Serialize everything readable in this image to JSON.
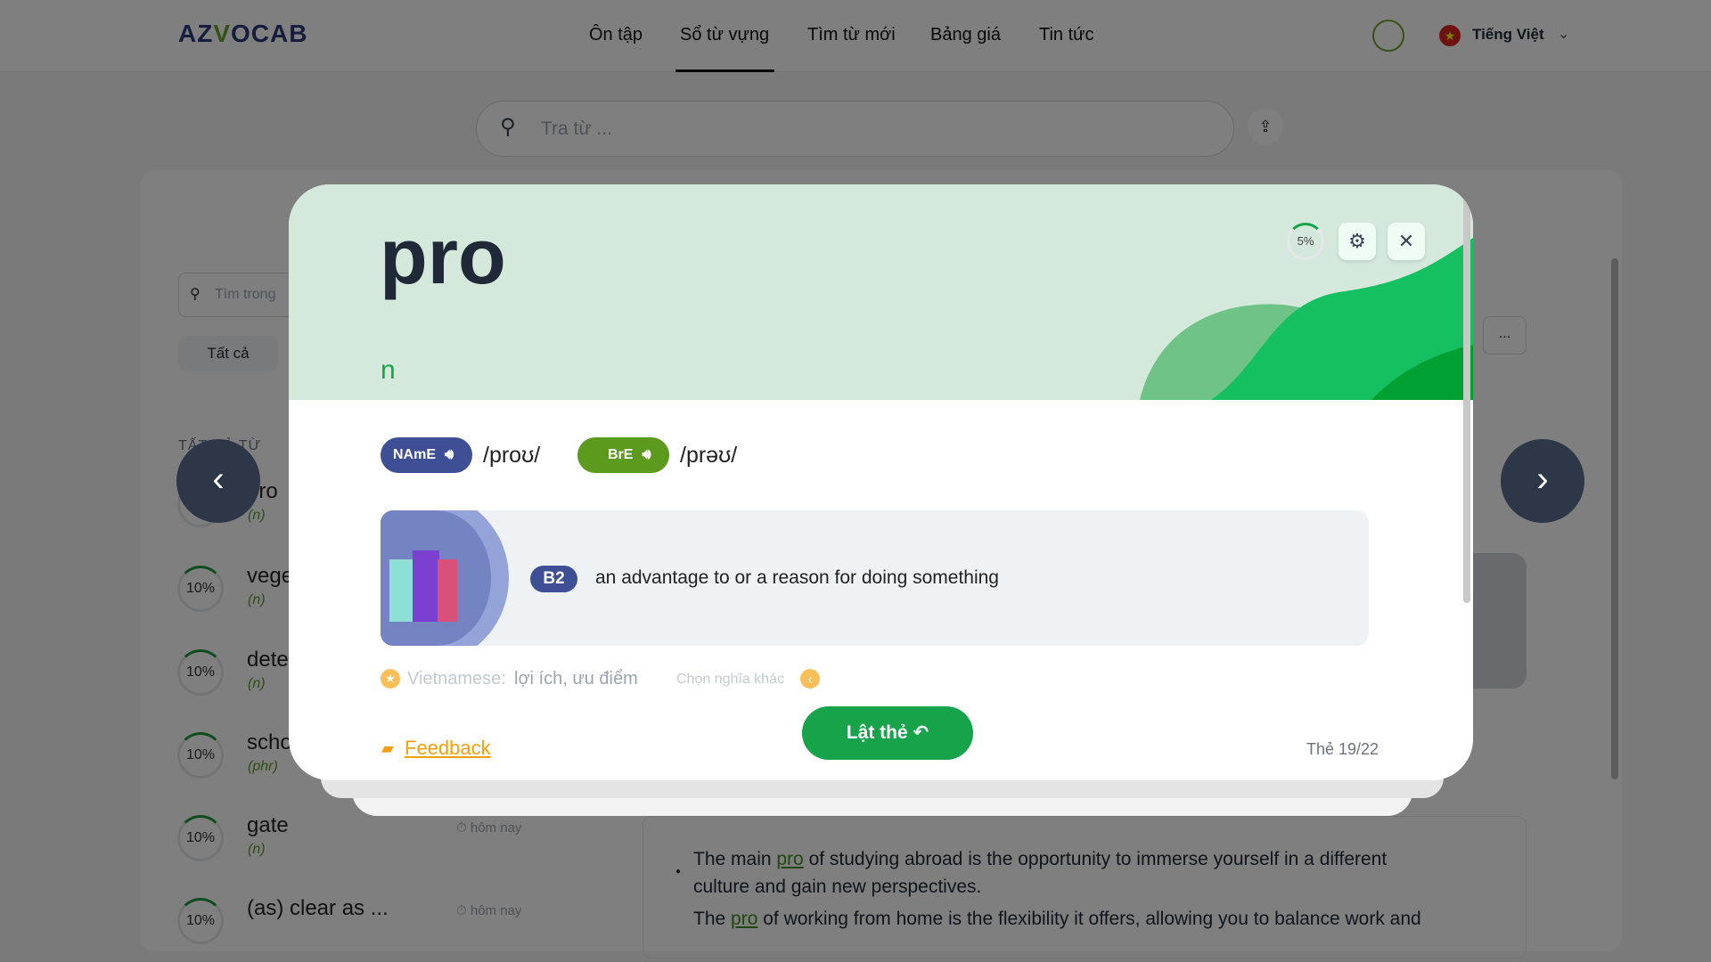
{
  "header": {
    "logo": "AZVOCAB",
    "nav": [
      "Ôn tập",
      "Sổ từ vựng",
      "Tìm từ mới",
      "Bảng giá",
      "Tin tức"
    ],
    "active_nav": "Sổ từ vựng",
    "language": "Tiếng Việt"
  },
  "search": {
    "placeholder": "Tra từ ..."
  },
  "left": {
    "filter_placeholder": "Tìm trong",
    "filter_all": "Tất cả",
    "section": "TẤT CẢ TỪ",
    "items": [
      {
        "word": "pro",
        "pos": "(n)",
        "progress": "5%"
      },
      {
        "word": "vege",
        "pos": "(n)",
        "progress": "10%"
      },
      {
        "word": "dete",
        "pos": "(n)",
        "progress": "10%"
      },
      {
        "word": "scho",
        "pos": "(phr)",
        "progress": "10%"
      },
      {
        "word": "gate",
        "pos": "(n)",
        "progress": "10%",
        "time": "hôm nay"
      },
      {
        "word": "(as) clear as ...",
        "pos": "",
        "progress": "10%",
        "time": "hôm nay"
      }
    ]
  },
  "more_label": "...",
  "examples": {
    "line1_a": "The main ",
    "line1_word": "pro",
    "line1_b": " of studying abroad is the opportunity to immerse yourself in a different",
    "line2": "culture and gain new perspectives.",
    "line3_a": "The ",
    "line3_word": "pro",
    "line3_b": " of working from home is the flexibility it offers, allowing you to balance work and"
  },
  "card": {
    "word": "pro",
    "pos": "n",
    "progress": "5%",
    "progress_value": 5,
    "name_label": "NAmE",
    "name_ipa": "/proʊ/",
    "bre_label": "BrE",
    "bre_ipa": "/prəʊ/",
    "level": "B2",
    "definition": "an advantage to or a reason for doing something",
    "vn_label": "Vietnamese:",
    "vn_meaning": "lợi ích, ưu điểm",
    "other_meaning": "Chọn nghĩa khác",
    "feedback": "Feedback",
    "flip": "Lật thẻ",
    "counter": "Thẻ 19/22"
  },
  "colors": {
    "name_pill": "#3f4f96",
    "bre_pill": "#5b9a1d",
    "flip": "#16a34a",
    "feedback": "#f59e0b",
    "header_bg": "#d4e8dc"
  }
}
